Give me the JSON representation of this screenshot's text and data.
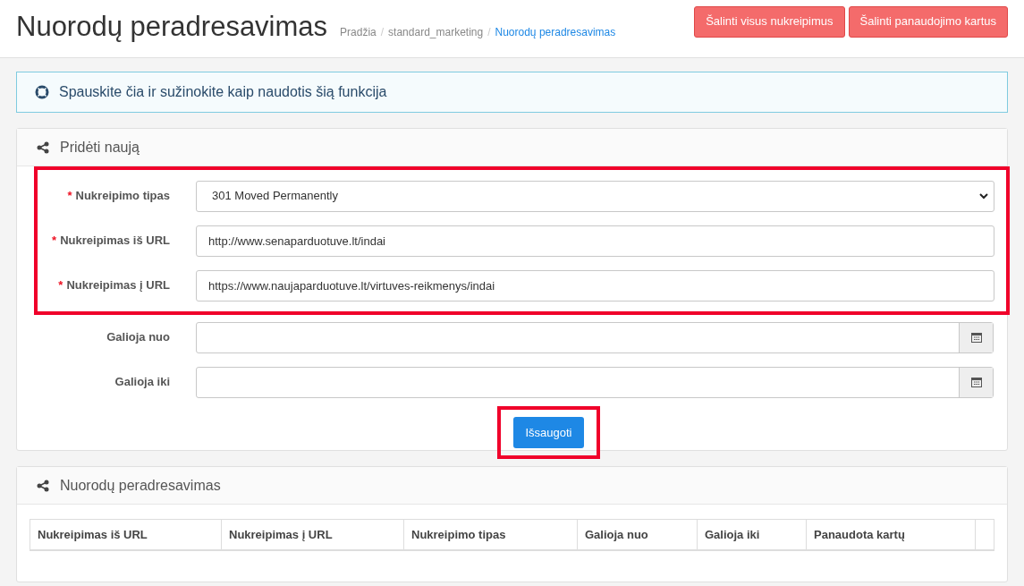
{
  "header": {
    "title": "Nuorodų peradresavimas",
    "breadcrumb_separator": "/",
    "breadcrumb": [
      {
        "label": "Pradžia",
        "selected": false
      },
      {
        "label": "standard_marketing",
        "selected": false
      },
      {
        "label": "Nuorodų peradresavimas",
        "selected": true
      }
    ],
    "buttons": [
      "Šalinti visus nukreipimus",
      "Šalinti panaudojimo kartus"
    ]
  },
  "help_link": "Spauskite čia ir sužinokite kaip naudotis šią funkcija",
  "add_panel": {
    "title": "Pridėti naują",
    "required_mark": "*",
    "fields": [
      {
        "kind": "select",
        "label": "Nukreipimo tipas",
        "required": true,
        "value": "301 Moved Permanently",
        "highlighted": true
      },
      {
        "kind": "text",
        "label": "Nukreipimas iš URL",
        "required": true,
        "value": "http://www.senaparduotuve.lt/indai",
        "highlighted": true
      },
      {
        "kind": "text",
        "label": "Nukreipimas į URL",
        "required": true,
        "value": "https://www.naujaparduotuve.lt/virtuves-reikmenys/indai",
        "highlighted": true
      },
      {
        "kind": "date",
        "label": "Galioja nuo",
        "required": false,
        "highlighted": false
      },
      {
        "kind": "date",
        "label": "Galioja iki",
        "required": false,
        "highlighted": false
      }
    ],
    "save_button": "Išsaugoti"
  },
  "list_panel": {
    "title": "Nuorodų peradresavimas",
    "table": {
      "columns": [
        "Nukreipimas iš URL",
        "Nukreipimas į URL",
        "Nukreipimo tipas",
        "Galioja nuo",
        "Galioja iki",
        "Panaudota kartų"
      ]
    }
  }
}
